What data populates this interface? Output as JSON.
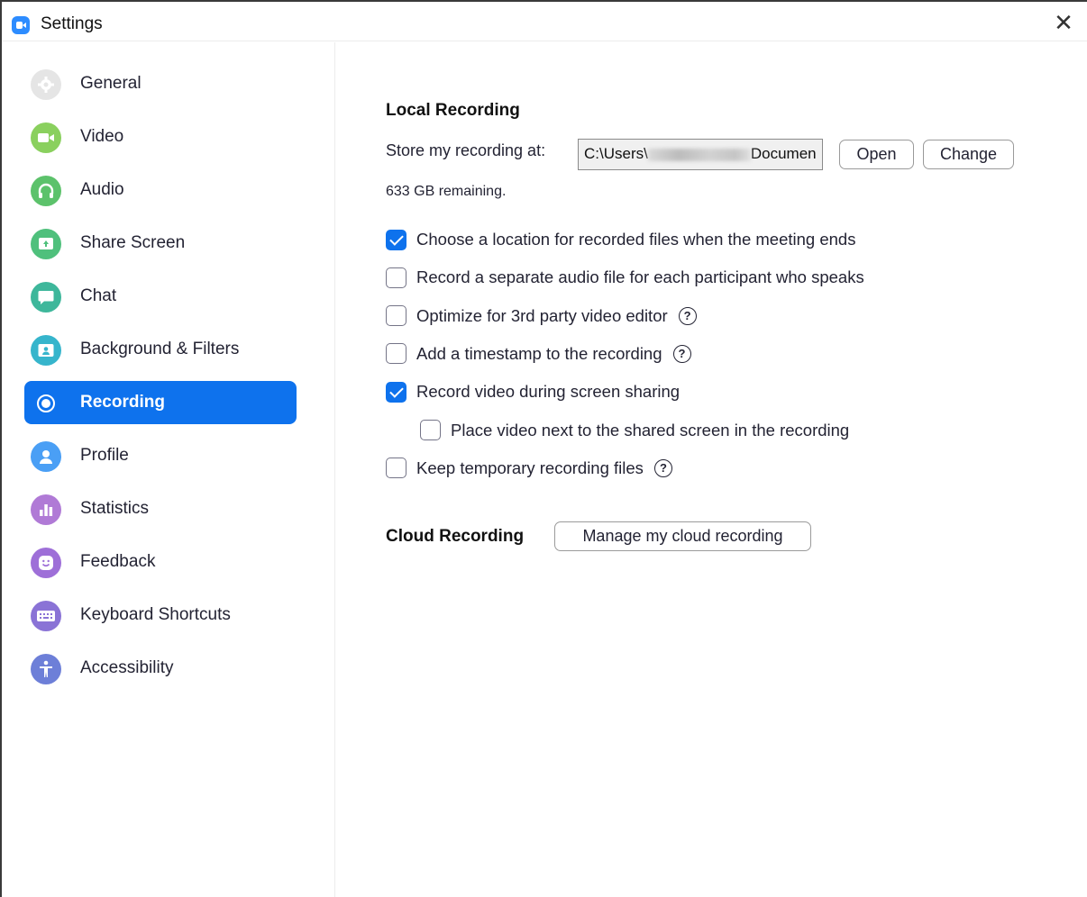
{
  "window": {
    "title": "Settings",
    "close_glyph": "✕"
  },
  "sidebar": {
    "items": [
      {
        "label": "General",
        "icon": "gear-icon",
        "color": "#e5e5e5",
        "active": false
      },
      {
        "label": "Video",
        "icon": "video-camera-icon",
        "color": "#8ad05e",
        "active": false
      },
      {
        "label": "Audio",
        "icon": "headphones-icon",
        "color": "#5cc26b",
        "active": false
      },
      {
        "label": "Share Screen",
        "icon": "share-screen-icon",
        "color": "#4fc07c",
        "active": false
      },
      {
        "label": "Chat",
        "icon": "chat-bubble-icon",
        "color": "#3eb79b",
        "active": false
      },
      {
        "label": "Background & Filters",
        "icon": "background-person-icon",
        "color": "#36b5cc",
        "active": false
      },
      {
        "label": "Recording",
        "icon": "record-icon",
        "color": "#0e72ed",
        "active": true
      },
      {
        "label": "Profile",
        "icon": "profile-person-icon",
        "color": "#4a9ff5",
        "active": false
      },
      {
        "label": "Statistics",
        "icon": "bar-chart-icon",
        "color": "#b07ad6",
        "active": false
      },
      {
        "label": "Feedback",
        "icon": "smiley-icon",
        "color": "#9e6fd8",
        "active": false
      },
      {
        "label": "Keyboard Shortcuts",
        "icon": "keyboard-icon",
        "color": "#8a73d6",
        "active": false
      },
      {
        "label": "Accessibility",
        "icon": "accessibility-person-icon",
        "color": "#6d7fd8",
        "active": false
      }
    ]
  },
  "local_recording": {
    "title": "Local Recording",
    "store_label": "Store my recording at:",
    "path_prefix": "C:\\Users\\",
    "path_suffix": "Documen",
    "open_label": "Open",
    "change_label": "Change",
    "remaining": "633 GB remaining.",
    "options": [
      {
        "label": "Choose a location for recorded files when the meeting ends",
        "checked": true,
        "help": false,
        "indent": false
      },
      {
        "label": "Record a separate audio file for each participant who speaks",
        "checked": false,
        "help": false,
        "indent": false
      },
      {
        "label": "Optimize for 3rd party video editor",
        "checked": false,
        "help": true,
        "indent": false
      },
      {
        "label": "Add a timestamp to the recording",
        "checked": false,
        "help": true,
        "indent": false
      },
      {
        "label": "Record video during screen sharing",
        "checked": true,
        "help": false,
        "indent": false
      },
      {
        "label": "Place video next to the shared screen in the recording",
        "checked": false,
        "help": false,
        "indent": true
      },
      {
        "label": "Keep temporary recording files",
        "checked": false,
        "help": true,
        "indent": false
      }
    ],
    "help_glyph": "?"
  },
  "cloud_recording": {
    "title": "Cloud Recording",
    "manage_label": "Manage my cloud recording"
  },
  "colors": {
    "accent": "#0e72ed",
    "text": "#232333"
  }
}
